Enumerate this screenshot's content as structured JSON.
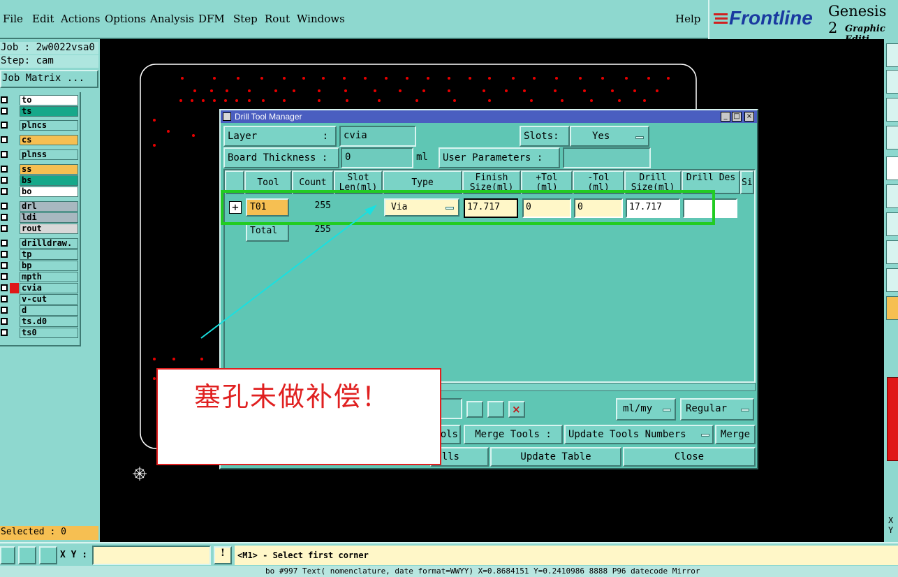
{
  "menu": {
    "file": "File",
    "edit": "Edit",
    "actions": "Actions",
    "options": "Options",
    "analysis": "Analysis",
    "dfm": "DFM",
    "step": "Step",
    "rout": "Rout",
    "windows": "Windows",
    "help": "Help"
  },
  "brand": {
    "logo": "Frontline",
    "product": "Genesis 2",
    "edition": "Graphic Editi"
  },
  "left": {
    "job": "Job : 2w0022vsa0",
    "step": "Step: cam",
    "job_matrix": "Job Matrix ...",
    "selected": "Selected : 0"
  },
  "layers": [
    {
      "name": "to",
      "color": "#ffffff"
    },
    {
      "name": "ts",
      "color": "#16a88a"
    },
    {
      "name": "plncs",
      "color": "#8ed8cf"
    },
    {
      "name": "cs",
      "color": "#f6bf52"
    },
    {
      "name": "plnss",
      "color": "#8ed8cf"
    },
    {
      "name": "ss",
      "color": "#f6bf52"
    },
    {
      "name": "bs",
      "color": "#16a88a"
    },
    {
      "name": "bo",
      "color": "#ffffff"
    },
    {
      "name": "drl",
      "color": "#a8b8c0"
    },
    {
      "name": "ldi",
      "color": "#a8b8c0"
    },
    {
      "name": "rout",
      "color": "#d8d8d8"
    },
    {
      "name": "drilldraw.",
      "color": "#8ed8cf"
    },
    {
      "name": "tp",
      "color": "#8ed8cf"
    },
    {
      "name": "bp",
      "color": "#8ed8cf"
    },
    {
      "name": "mpth",
      "color": "#8ed8cf"
    },
    {
      "name": "cvia",
      "color": "#8ed8cf"
    },
    {
      "name": "v-cut",
      "color": "#8ed8cf"
    },
    {
      "name": "d",
      "color": "#8ed8cf"
    },
    {
      "name": "ts.d0",
      "color": "#8ed8cf"
    },
    {
      "name": "ts0",
      "color": "#8ed8cf"
    }
  ],
  "dialog": {
    "title": "Drill Tool Manager",
    "layer_label": "Layer",
    "layer_colon": ":",
    "layer_value": "cvia",
    "slots_label": "Slots:",
    "slots_value": "Yes",
    "board_thickness_label": "Board Thickness :",
    "board_thickness_value": "0",
    "board_thickness_unit": "ml",
    "user_params_label": "User Parameters :",
    "user_params_value": "",
    "columns": {
      "tool": "Tool",
      "count": "Count",
      "slot_len": "Slot Len(ml)",
      "type": "Type",
      "finish": "Finish Size(ml)",
      "ptol": "+Tol (ml)",
      "mtol": "-Tol (ml)",
      "drill": "Drill Size(ml)",
      "drill_des": "Drill Des",
      "si": "Si"
    },
    "row": {
      "tool": "T01",
      "count": "255",
      "type": "Via",
      "finish": "17.717",
      "ptol": "0",
      "mtol": "0",
      "drill": "17.717",
      "drill_des": ""
    },
    "total": {
      "label": "Total",
      "count": "255"
    },
    "units_value": "ml/my",
    "mode_value": "Regular",
    "tools_fragment": "ols",
    "merge_tools_label": "Merge Tools :",
    "update_numbers_value": "Update Tools Numbers",
    "merge_button": "Merge",
    "lls_fragment": "lls",
    "update_table_button": "Update Table",
    "close_button": "Close"
  },
  "annotation": {
    "text": "塞孔未做补偿！"
  },
  "bottom": {
    "xy_label": "X Y :",
    "xy_value": "",
    "prompt": "<M1> - Select first corner",
    "status": "bo #997 Text( nomenclature, date format=WWYY) X=0.8684151 Y=0.2410986 8888 P96 datecode Mirror"
  },
  "right_readout": "X\nY",
  "colors": {
    "menu_teal": "#8ed8cf",
    "highlight_green": "#22cc22",
    "arrow_cyan": "#19e0e0",
    "annotation_red": "#e02020"
  }
}
